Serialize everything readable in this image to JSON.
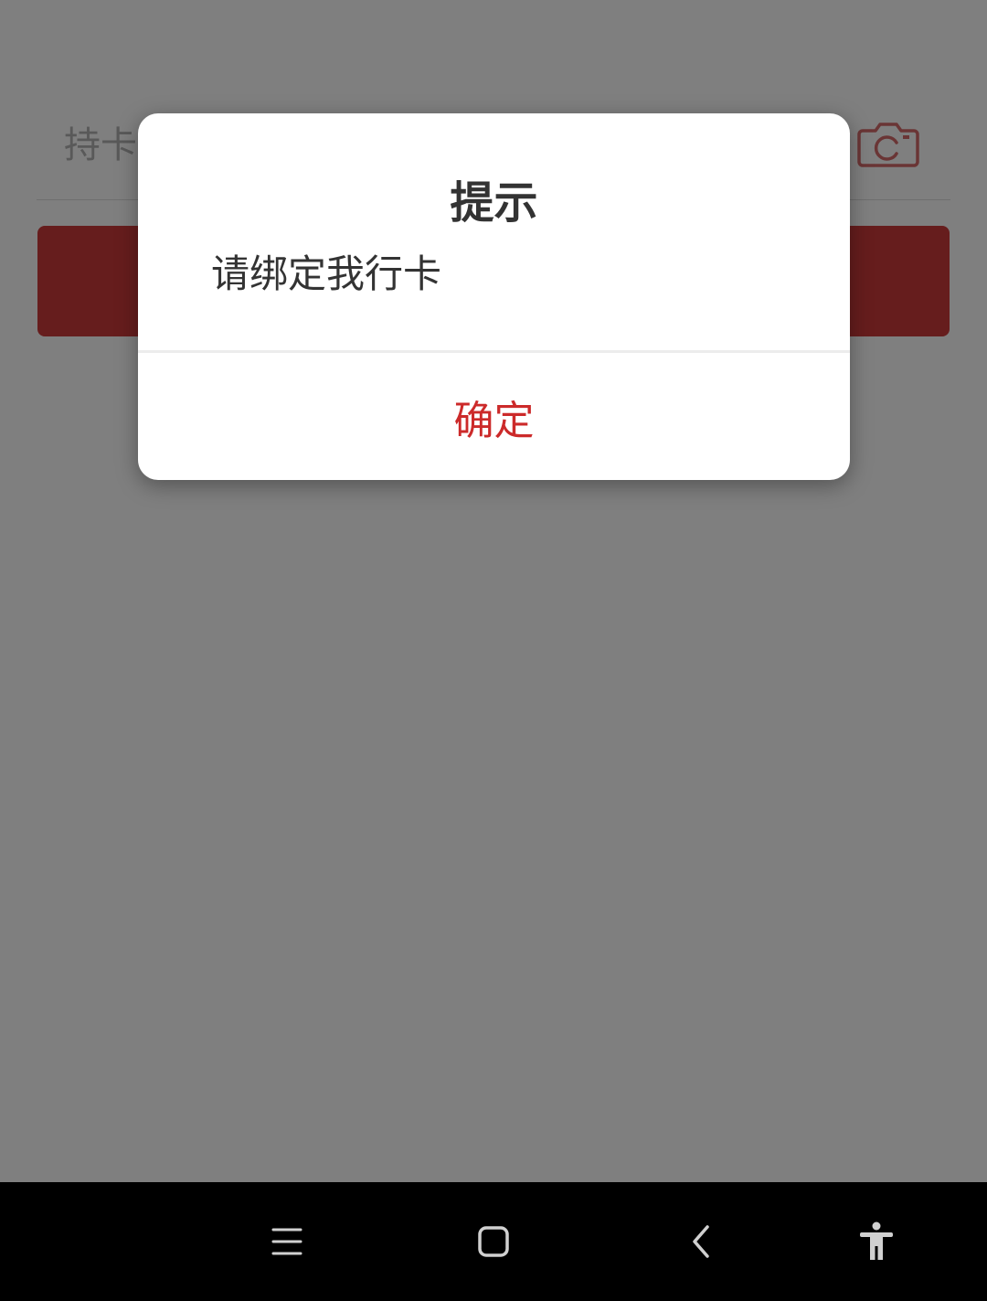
{
  "app": {
    "card_field": {
      "placeholder": "持卡人卡号"
    },
    "primary_button": {
      "label": ""
    },
    "colors": {
      "accent": "#cc3a3a",
      "camera_icon": "#d46a6a"
    },
    "camera_icon": "camera-icon"
  },
  "dialog": {
    "title": "提示",
    "message": "请绑定我行卡",
    "confirm_label": "确定",
    "confirm_color": "#cc2a2a"
  },
  "nav_bar": {
    "icons": [
      "menu-icon",
      "home-icon",
      "back-icon",
      "accessibility-icon"
    ]
  }
}
